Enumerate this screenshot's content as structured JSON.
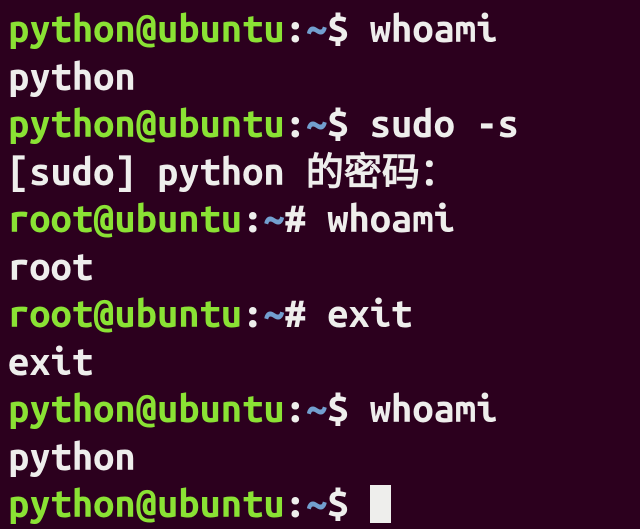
{
  "lines": [
    {
      "type": "prompt",
      "userhost": "python@ubuntu",
      "path": "~",
      "sym": "$",
      "command": "whoami"
    },
    {
      "type": "output",
      "text": "python"
    },
    {
      "type": "prompt",
      "userhost": "python@ubuntu",
      "path": "~",
      "sym": "$",
      "command": "sudo -s"
    },
    {
      "type": "output",
      "text": "[sudo] python 的密码："
    },
    {
      "type": "prompt",
      "userhost": "root@ubuntu",
      "path": "~",
      "sym": "#",
      "command": "whoami"
    },
    {
      "type": "output",
      "text": "root"
    },
    {
      "type": "prompt",
      "userhost": "root@ubuntu",
      "path": "~",
      "sym": "#",
      "command": "exit"
    },
    {
      "type": "output",
      "text": "exit"
    },
    {
      "type": "prompt",
      "userhost": "python@ubuntu",
      "path": "~",
      "sym": "$",
      "command": "whoami"
    },
    {
      "type": "output",
      "text": "python"
    },
    {
      "type": "prompt",
      "userhost": "python@ubuntu",
      "path": "~",
      "sym": "$",
      "command": "",
      "cursor": true
    }
  ]
}
